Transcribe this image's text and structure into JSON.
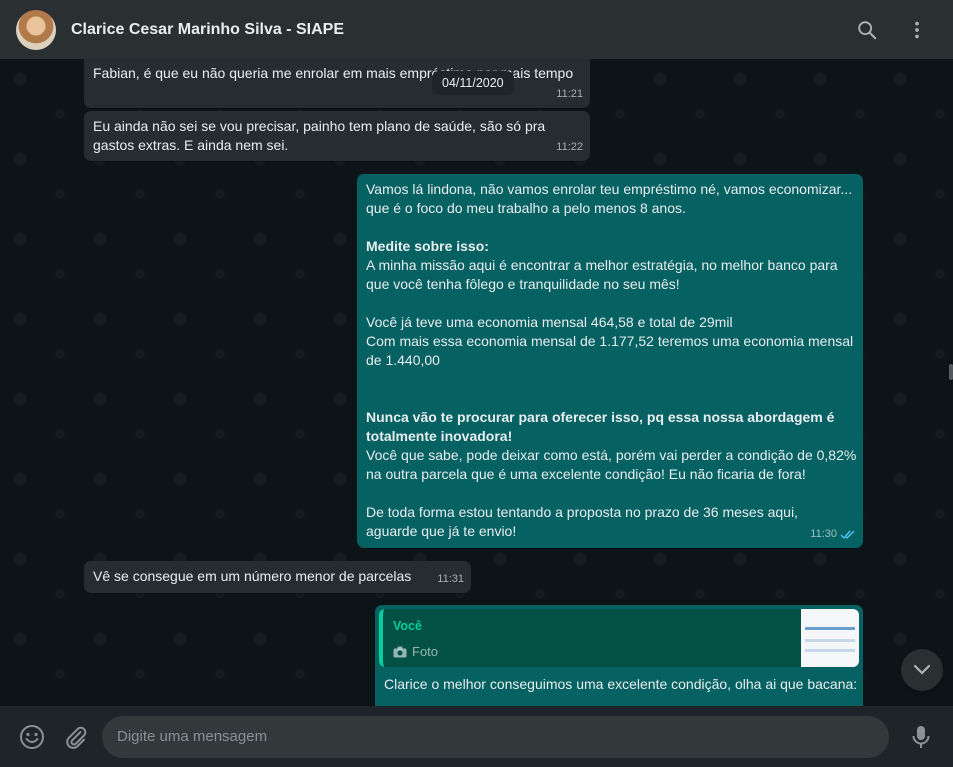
{
  "header": {
    "title": "Clarice Cesar Marinho Silva - SIAPE"
  },
  "date_chip": "04/11/2020",
  "messages": [
    {
      "lines": [
        "Fabian, é que eu não queria me enrolar em mais empréstimo por mais tempo"
      ],
      "time": "11:21"
    },
    {
      "lines": [
        "Eu ainda não sei se vou precisar, painho tem plano de saúde, são só pra",
        "gastos extras. E ainda nem sei."
      ],
      "time": "11:22"
    },
    {
      "lines": [
        "Vamos lá lindona, não vamos enrolar teu empréstimo né, vamos economizar...",
        "que é o foco do meu trabalho a pelo menos 8 anos.",
        "",
        "Medite sobre isso:",
        "A minha missão aqui é encontrar a melhor estratégia, no melhor banco para",
        "que você tenha fôlego e tranquilidade no seu mês!",
        "",
        "Você já teve uma economia mensal 464,58 e total de 29mil",
        "Com mais essa economia mensal de 1.177,52 teremos uma economia mensal",
        "de 1.440,00",
        "",
        "",
        "Nunca vão te procurar para oferecer isso, pq essa nossa abordagem é",
        "totalmente inovadora!",
        "Você que sabe, pode deixar como está, porém vai perder a condição de 0,82%",
        "na outra parcela que é uma excelente condição! Eu não ficaria de fora!",
        "",
        "De toda forma estou tentando a proposta no prazo de 36 meses aqui,",
        "aguarde que já te envio!"
      ],
      "time": "11:30"
    },
    {
      "lines": [
        "Vê se consegue em um número menor de parcelas"
      ],
      "time": "11:31"
    },
    {
      "quote_author": "Você",
      "quote_text": "Foto",
      "lines": [
        "Clarice o melhor conseguimos uma excelente condição, olha ai que bacana:"
      ]
    }
  ],
  "composer": {
    "placeholder": "Digite uma mensagem"
  },
  "colors": {
    "header_bg": "#2a2f32",
    "chat_bg": "#0d1418",
    "incoming_bubble": "#262d31",
    "outgoing_bubble": "#056162",
    "read_ticks": "#4fc3f7",
    "quote_accent": "#06cf9c"
  },
  "icons": [
    "avatar",
    "search-icon",
    "menu-icon",
    "double-check-icon",
    "camera-icon",
    "chevron-down-icon",
    "emoji-icon",
    "attach-icon",
    "mic-icon"
  ]
}
